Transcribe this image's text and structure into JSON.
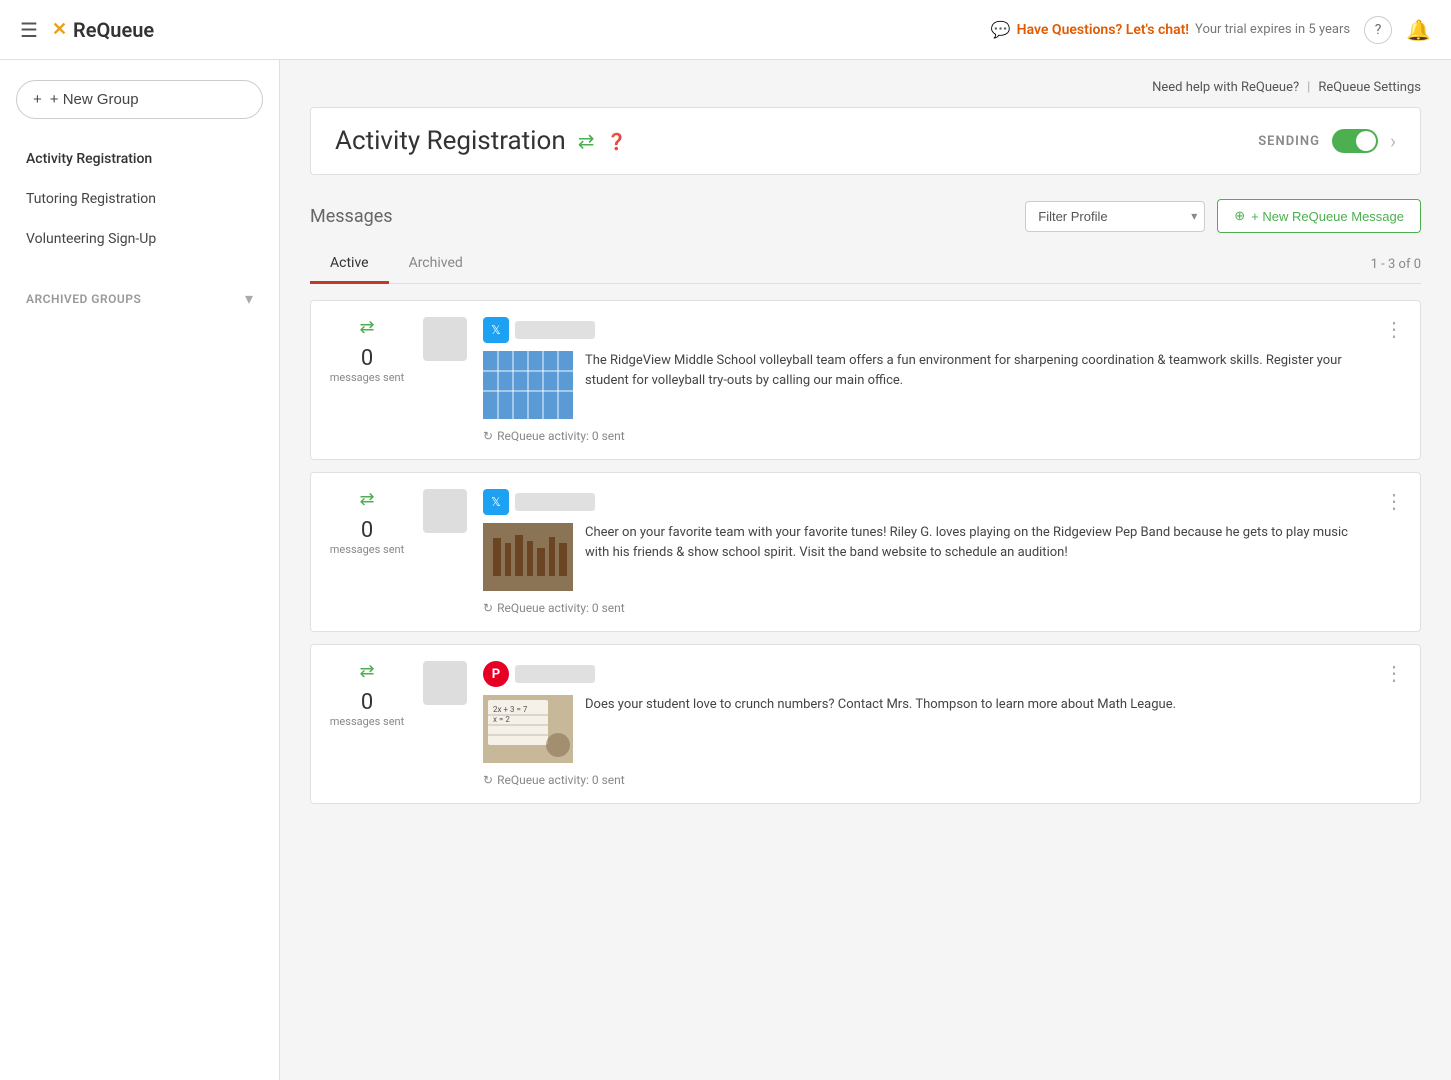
{
  "app": {
    "name": "ReQueue",
    "logo_icon": "✕"
  },
  "topnav": {
    "hamburger": "≡",
    "chat_link": "Have Questions? Let's chat!",
    "trial_text": "Your trial expires in 5 years",
    "help_icon": "?",
    "bell_icon": "🔔",
    "help_link": "Need help with ReQueue?",
    "settings_link": "ReQueue Settings"
  },
  "sidebar": {
    "new_group_label": "+ New Group",
    "nav_items": [
      {
        "label": "Activity Registration",
        "active": true
      },
      {
        "label": "Tutoring Registration",
        "active": false
      },
      {
        "label": "Volunteering Sign-Up",
        "active": false
      }
    ],
    "archived_label": "ARCHIVED GROUPS"
  },
  "group": {
    "title": "Activity Registration",
    "sending_label": "SENDING",
    "toggle_on": true
  },
  "messages_section": {
    "title": "Messages",
    "filter_placeholder": "Filter Profile",
    "new_message_label": "+ New ReQueue Message",
    "tabs": [
      {
        "label": "Active",
        "active": true
      },
      {
        "label": "Archived",
        "active": false
      }
    ],
    "pagination": "1 - 3 of 0",
    "messages": [
      {
        "id": 1,
        "count": "0",
        "sent_label": "messages sent",
        "platform": "twitter",
        "text": "The RidgeView Middle School volleyball team offers a fun environment for sharpening coordination & teamwork skills. Register your student for volleyball try-outs by calling our main office.",
        "activity": "ReQueue activity: 0 sent",
        "image_type": "volleyball"
      },
      {
        "id": 2,
        "count": "0",
        "sent_label": "messages sent",
        "platform": "twitter",
        "text": "Cheer on your favorite team with your favorite tunes! Riley G. loves playing on the Ridgeview Pep Band because he gets to play music with his friends & show school spirit. Visit the band website to schedule an audition!",
        "activity": "ReQueue activity: 0 sent",
        "image_type": "band"
      },
      {
        "id": 3,
        "count": "0",
        "sent_label": "messages sent",
        "platform": "pinterest",
        "text": "Does your student love to crunch numbers? Contact Mrs. Thompson to learn more about Math League.",
        "activity": "ReQueue activity: 0 sent",
        "image_type": "math"
      }
    ]
  }
}
